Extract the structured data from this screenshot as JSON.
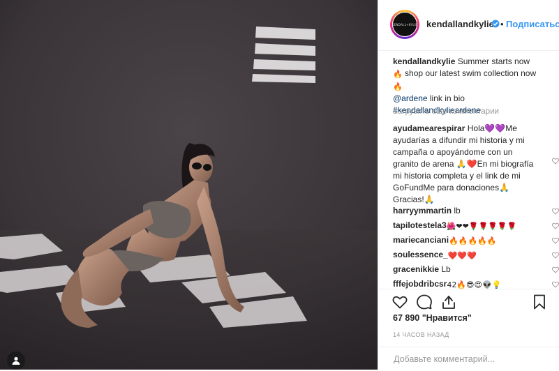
{
  "post": {
    "username": "kendallandkylie",
    "follow_label": "Подписаться",
    "dot": "•",
    "avatar_text": "KENDALL+KYLIE",
    "caption": {
      "username": "kendallandkylie",
      "text1": " Summer starts now ",
      "text2": " shop our latest swim collection now ",
      "mention": "@ardene",
      "text3": " link in bio ",
      "hashtag": "#kendallandkyliea​rdene"
    },
    "load_more": "Загрузить еще комментарии",
    "comments": [
      {
        "user": "ayudamearespirar",
        "text": " Hola💜💜Me ayudarías a difundir mi historia y mi campaña o apoyándome con un granito de arena 🙏❤️En mi biografía mi historia completa y el link de mi GoFundMe para donaciones🙏 Gracias!🙏"
      },
      {
        "user": "harryymmartin",
        "text": " lb"
      },
      {
        "user": "tapilotestela3",
        "text": " 🌺❤❤🌹🌹🌹🌹🌹"
      },
      {
        "user": "mariecanciani",
        "text": " 🔥🔥🔥🔥🔥"
      },
      {
        "user": "soulessence_",
        "text": " ❤️❤️❤️"
      },
      {
        "user": "gracenikkie",
        "text": " Lb"
      },
      {
        "user": "fffejobdribcsr",
        "text": " 42🔥😎😍👽💡"
      }
    ],
    "likes_count": "67 890",
    "likes_label": " \"Нравится\"",
    "time_ago": "14 ЧАСОВ НАЗАД",
    "add_comment_placeholder": "Добавьте комментарий..."
  },
  "colors": {
    "link": "#003569",
    "follow": "#3897f0",
    "verified": "#3897f0",
    "muted": "#999999"
  },
  "icons": [
    "verified-badge-icon",
    "heart-icon",
    "comment-icon",
    "share-icon",
    "bookmark-icon",
    "tag-person-icon"
  ]
}
